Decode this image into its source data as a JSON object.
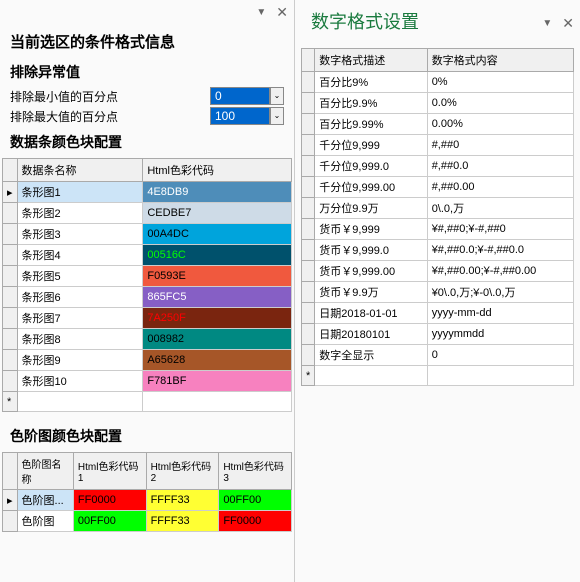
{
  "left": {
    "title": "当前选区的条件格式信息",
    "outlier": {
      "title": "排除异常值",
      "minLabel": "排除最小值的百分点",
      "maxLabel": "排除最大值的百分点",
      "minValue": "0",
      "maxValue": "100"
    },
    "databar": {
      "title": "数据条颜色块配置",
      "headers": {
        "name": "数据条名称",
        "code": "Html色彩代码"
      },
      "rows": [
        {
          "name": "条形图1",
          "code": "4E8DB9",
          "bg": "#4E8DB9",
          "fg": "#fff",
          "sel": true
        },
        {
          "name": "条形图2",
          "code": "CEDBE7",
          "bg": "#CEDBE7",
          "fg": "#000"
        },
        {
          "name": "条形图3",
          "code": "00A4DC",
          "bg": "#00A4DC",
          "fg": "#000"
        },
        {
          "name": "条形图4",
          "code": "00516C",
          "bg": "#00516C",
          "fg": "#0f0"
        },
        {
          "name": "条形图5",
          "code": "F0593E",
          "bg": "#F0593E",
          "fg": "#000"
        },
        {
          "name": "条形图6",
          "code": "865FC5",
          "bg": "#865FC5",
          "fg": "#fff"
        },
        {
          "name": "条形图7",
          "code": "7A250F",
          "bg": "#7A250F",
          "fg": "#f00"
        },
        {
          "name": "条形图8",
          "code": "008982",
          "bg": "#008982",
          "fg": "#000"
        },
        {
          "name": "条形图9",
          "code": "A65628",
          "bg": "#A65628",
          "fg": "#000"
        },
        {
          "name": "条形图10",
          "code": "F781BF",
          "bg": "#F781BF",
          "fg": "#000"
        }
      ]
    },
    "gradient": {
      "title": "色阶图颜色块配置",
      "headers": {
        "name": "色阶图名称",
        "c1": "Html色彩代码1",
        "c2": "Html色彩代码2",
        "c3": "Html色彩代码3"
      },
      "rows": [
        {
          "name": "色阶图...",
          "c1": "FF0000",
          "b1": "#FF0000",
          "c2": "FFFF33",
          "b2": "#FFFF33",
          "c3": "00FF00",
          "b3": "#00FF00"
        },
        {
          "name": "色阶图",
          "c1": "00FF00",
          "b1": "#00FF00",
          "c2": "FFFF33",
          "b2": "#FFFF33",
          "c3": "FF0000",
          "b3": "#FF0000"
        }
      ]
    }
  },
  "right": {
    "title": "数字格式设置",
    "headers": {
      "desc": "数字格式描述",
      "content": "数字格式内容"
    },
    "rows": [
      {
        "d": "百分比9%",
        "c": "0%"
      },
      {
        "d": "百分比9.9%",
        "c": "0.0%"
      },
      {
        "d": "百分比9.99%",
        "c": "0.00%"
      },
      {
        "d": "千分位9,999",
        "c": "#,##0"
      },
      {
        "d": "千分位9,999.0",
        "c": "#,##0.0"
      },
      {
        "d": "千分位9,999.00",
        "c": "#,##0.00"
      },
      {
        "d": "万分位9.9万",
        "c": "0\\.0,万"
      },
      {
        "d": "货币￥9,999",
        "c": "¥#,##0;¥-#,##0"
      },
      {
        "d": "货币￥9,999.0",
        "c": "¥#,##0.0;¥-#,##0.0"
      },
      {
        "d": "货币￥9,999.00",
        "c": "¥#,##0.00;¥-#,##0.00"
      },
      {
        "d": "货币￥9.9万",
        "c": "¥0\\.0,万;¥-0\\.0,万"
      },
      {
        "d": "日期2018-01-01",
        "c": "yyyy-mm-dd"
      },
      {
        "d": "日期20180101",
        "c": "yyyymmdd"
      },
      {
        "d": "数字全显示",
        "c": "0"
      }
    ]
  }
}
